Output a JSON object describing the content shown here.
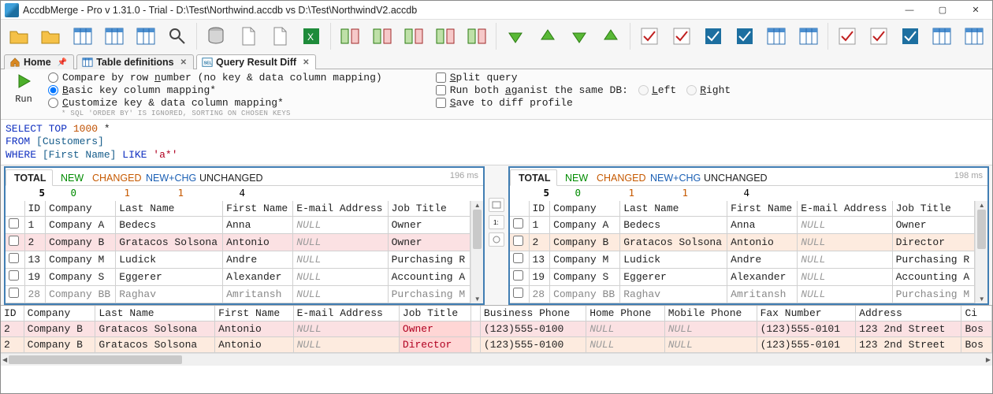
{
  "window": {
    "title": "AccdbMerge - Pro v 1.31.0 - Trial - D:\\Test\\Northwind.accdb vs D:\\Test\\NorthwindV2.accdb"
  },
  "win_controls": {
    "min": "—",
    "max": "▢",
    "close": "✕"
  },
  "toolbar_icons": [
    "open-file-icon",
    "open-folder-icon",
    "compare-icon",
    "compare-sel-icon",
    "compare-cfg-icon",
    "find-icon",
    "db-refresh-icon",
    "copy-single-icon",
    "copy-sheet-icon",
    "excel-export-icon",
    "merge-left-icon",
    "merge-left-all-icon",
    "merge-right-all-icon",
    "merge-right-icon",
    "merge-center-icon",
    "arrow-down-green-icon",
    "arrow-up-green-icon",
    "arrow-down-double-icon",
    "arrow-up-double-icon",
    "check-left-icon",
    "check-right-icon",
    "apply-left-icon",
    "apply-right-icon",
    "reject-left-icon",
    "reject-right-icon",
    "check-pair-icon",
    "check-pair-off-icon",
    "apply-pair-icon",
    "reject-pair-icon",
    "arrow-pair-icon"
  ],
  "tabs": {
    "home": {
      "label": "Home"
    },
    "defs": {
      "label": "Table definitions"
    },
    "qdiff": {
      "label": "Query Result Diff"
    }
  },
  "opts": {
    "run_label": "Run",
    "r1": "Compare by row number (no key & data column mapping)",
    "r2": "Basic key column mapping*",
    "r3": "Customize key & data column mapping*",
    "hint": "* SQL 'ORDER BY' IS IGNORED, SORTING ON CHOSEN KEYS",
    "c1": "Split query",
    "c2": "Run both aganist the same DB:",
    "c2_left": "Left",
    "c2_right": "Right",
    "c3": "Save to diff profile"
  },
  "sql": {
    "select_kw": "SELECT",
    "top_kw": "TOP",
    "top_n": "1000",
    "star": "*",
    "from_kw": "FROM",
    "from_obj": "[Customers]",
    "where_kw": "WHERE",
    "where_obj": "[First Name]",
    "like_kw": "LIKE",
    "like_str": "'a*'"
  },
  "pane_tabs": {
    "total": "TOTAL",
    "new": "NEW",
    "changed": "CHANGED",
    "newchg": "NEW+CHG",
    "unchanged": "UNCHANGED"
  },
  "left": {
    "timing": "196 ms",
    "counts": {
      "total": "5",
      "new": "0",
      "changed": "1",
      "newchg": "1",
      "unchanged": "4"
    },
    "cols": [
      "",
      "ID",
      "Company",
      "Last Name",
      "First Name",
      "E-mail Address",
      "Job Title"
    ],
    "rows": [
      {
        "id": "1",
        "company": "Company A",
        "last": "Bedecs",
        "first": "Anna",
        "email": "NULL",
        "job": "Owner"
      },
      {
        "id": "2",
        "company": "Company B",
        "last": "Gratacos Solsona",
        "first": "Antonio",
        "email": "NULL",
        "job": "Owner"
      },
      {
        "id": "13",
        "company": "Company M",
        "last": "Ludick",
        "first": "Andre",
        "email": "NULL",
        "job": "Purchasing R"
      },
      {
        "id": "19",
        "company": "Company S",
        "last": "Eggerer",
        "first": "Alexander",
        "email": "NULL",
        "job": "Accounting A"
      },
      {
        "id": "28",
        "company": "Company BB",
        "last": "Raghav",
        "first": "Amritansh",
        "email": "NULL",
        "job": "Purchasing M"
      }
    ]
  },
  "right": {
    "timing": "198 ms",
    "counts": {
      "total": "5",
      "new": "0",
      "changed": "1",
      "newchg": "1",
      "unchanged": "4"
    },
    "cols": [
      "",
      "ID",
      "Company",
      "Last Name",
      "First Name",
      "E-mail Address",
      "Job Title"
    ],
    "rows": [
      {
        "id": "1",
        "company": "Company A",
        "last": "Bedecs",
        "first": "Anna",
        "email": "NULL",
        "job": "Owner"
      },
      {
        "id": "2",
        "company": "Company B",
        "last": "Gratacos Solsona",
        "first": "Antonio",
        "email": "NULL",
        "job": "Director"
      },
      {
        "id": "13",
        "company": "Company M",
        "last": "Ludick",
        "first": "Andre",
        "email": "NULL",
        "job": "Purchasing R"
      },
      {
        "id": "19",
        "company": "Company S",
        "last": "Eggerer",
        "first": "Alexander",
        "email": "NULL",
        "job": "Accounting A"
      },
      {
        "id": "28",
        "company": "Company BB",
        "last": "Raghav",
        "first": "Amritansh",
        "email": "NULL",
        "job": "Purchasing M"
      }
    ]
  },
  "detail": {
    "cols": [
      "ID",
      "Company",
      "Last Name",
      "First Name",
      "E-mail Address",
      "Job Title",
      "",
      "Business Phone",
      "Home Phone",
      "Mobile Phone",
      "Fax Number",
      "Address",
      "Ci"
    ],
    "rows": [
      {
        "id": "2",
        "company": "Company B",
        "last": "Gratacos Solsona",
        "first": "Antonio",
        "email": "NULL",
        "job": "Owner",
        "bphone": "(123)555-0100",
        "hphone": "NULL",
        "mphone": "NULL",
        "fax": "(123)555-0101",
        "addr": "123 2nd Street",
        "ci": "Bos"
      },
      {
        "id": "2",
        "company": "Company B",
        "last": "Gratacos Solsona",
        "first": "Antonio",
        "email": "NULL",
        "job": "Director",
        "bphone": "(123)555-0100",
        "hphone": "NULL",
        "mphone": "NULL",
        "fax": "(123)555-0101",
        "addr": "123 2nd Street",
        "ci": "Bos"
      }
    ]
  }
}
